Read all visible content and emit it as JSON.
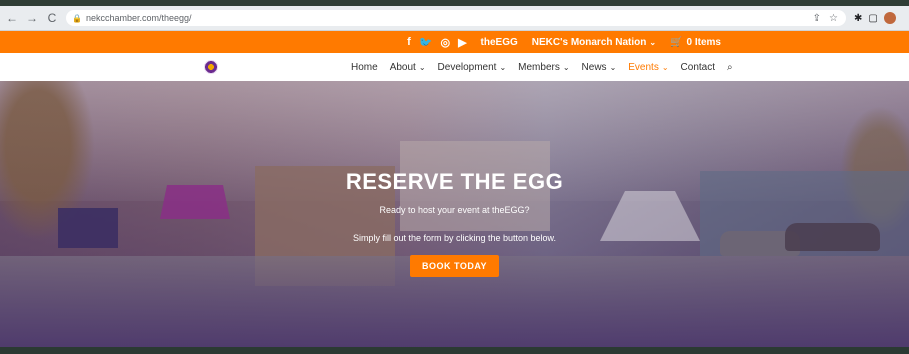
{
  "browser": {
    "url": "nekcchamber.com/theegg/"
  },
  "topbar": {
    "social_icons": [
      "facebook-icon",
      "twitter-icon",
      "instagram-icon",
      "youtube-icon"
    ],
    "links": [
      "theEGG",
      "NEKC's Monarch Nation"
    ],
    "cart_label": "0 Items"
  },
  "nav": {
    "items": [
      {
        "label": "Home",
        "has_caret": false,
        "active": false
      },
      {
        "label": "About",
        "has_caret": true,
        "active": false
      },
      {
        "label": "Development",
        "has_caret": true,
        "active": false
      },
      {
        "label": "Members",
        "has_caret": true,
        "active": false
      },
      {
        "label": "News",
        "has_caret": true,
        "active": false
      },
      {
        "label": "Events",
        "has_caret": true,
        "active": true
      },
      {
        "label": "Contact",
        "has_caret": false,
        "active": false
      }
    ],
    "search_icon": "search-icon"
  },
  "hero": {
    "title": "RESERVE THE EGG",
    "subtitle": "Ready to host your event at theEGG?",
    "instruction": "Simply fill out the form by clicking the button below.",
    "cta_label": "BOOK TODAY"
  },
  "colors": {
    "accent": "#ff7a00",
    "nav_text": "#333333",
    "white": "#ffffff"
  }
}
